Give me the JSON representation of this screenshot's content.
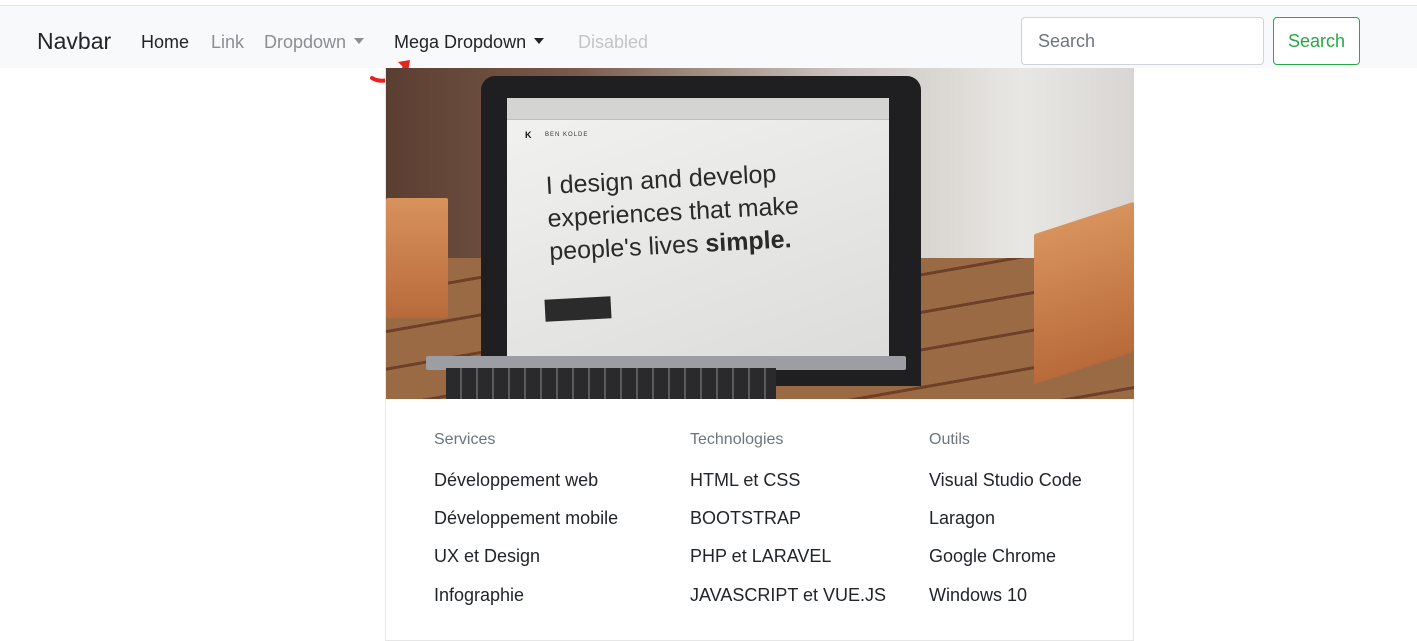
{
  "navbar": {
    "brand": "Navbar",
    "links": [
      {
        "label": "Home",
        "state": "active"
      },
      {
        "label": "Link",
        "state": "normal"
      },
      {
        "label": "Dropdown",
        "state": "normal"
      },
      {
        "label": "Mega Dropdown",
        "state": "active"
      },
      {
        "label": "Disabled",
        "state": "disabled"
      }
    ],
    "search": {
      "placeholder": "Search",
      "value": ""
    },
    "search_button": "Search"
  },
  "mega_menu": {
    "hero_image": {
      "site_name": "BEN KOLDE",
      "headline_line1": "I design and develop",
      "headline_line2": "experiences that make",
      "headline_line3_prefix": "people's lives ",
      "headline_line3_bold": "simple."
    },
    "columns": [
      {
        "title": "Services",
        "items": [
          "Développement web",
          "Développement mobile",
          "UX et Design",
          "Infographie"
        ]
      },
      {
        "title": "Technologies",
        "items": [
          "HTML et CSS",
          "BOOTSTRAP",
          "PHP et LARAVEL",
          "JAVASCRIPT et VUE.JS"
        ]
      },
      {
        "title": "Outils",
        "items": [
          "Visual Studio Code",
          "Laragon",
          "Google Chrome",
          "Windows 10"
        ]
      }
    ]
  },
  "colors": {
    "navbar_bg": "#f8f9fa",
    "link_muted": "#8a8f94",
    "link_disabled": "#c2c6ca",
    "success": "#28a745",
    "annotation_arrow": "#e8231f"
  }
}
